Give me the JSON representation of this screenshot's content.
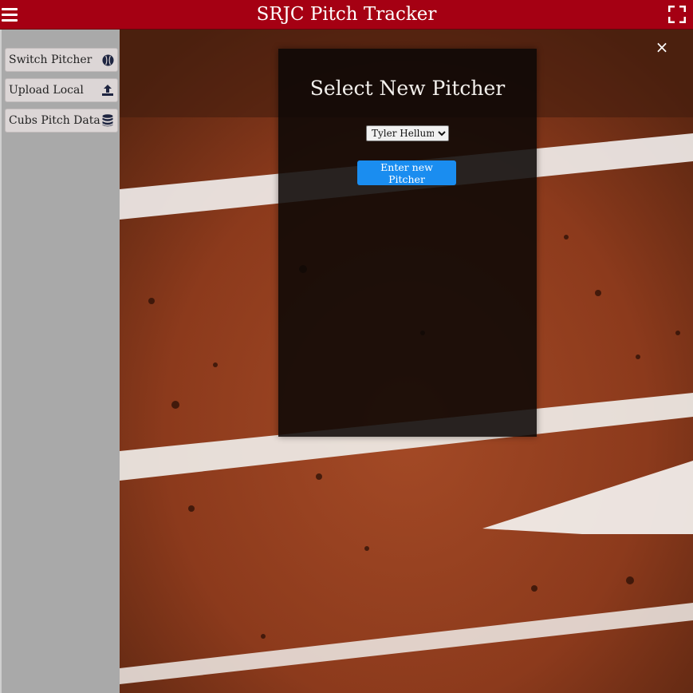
{
  "header": {
    "title": "SRJC Pitch Tracker",
    "menu_icon": "hamburger-icon",
    "fullscreen_icon": "fullscreen-icon",
    "bar_color": "#a50013"
  },
  "sidebar": {
    "items": [
      {
        "label": "Switch Pitcher",
        "icon": "baseball-icon"
      },
      {
        "label": "Upload Local",
        "icon": "upload-icon"
      },
      {
        "label": "Cubs Pitch Data",
        "icon": "database-icon"
      }
    ]
  },
  "modal": {
    "title": "Select New Pitcher",
    "select_value": "Tyler Hellums",
    "options": [
      "Tyler Hellums"
    ],
    "button_label": "Enter new Pitcher",
    "button_color": "#1a8df0",
    "close_icon": "close-icon",
    "close_glyph": "×"
  }
}
